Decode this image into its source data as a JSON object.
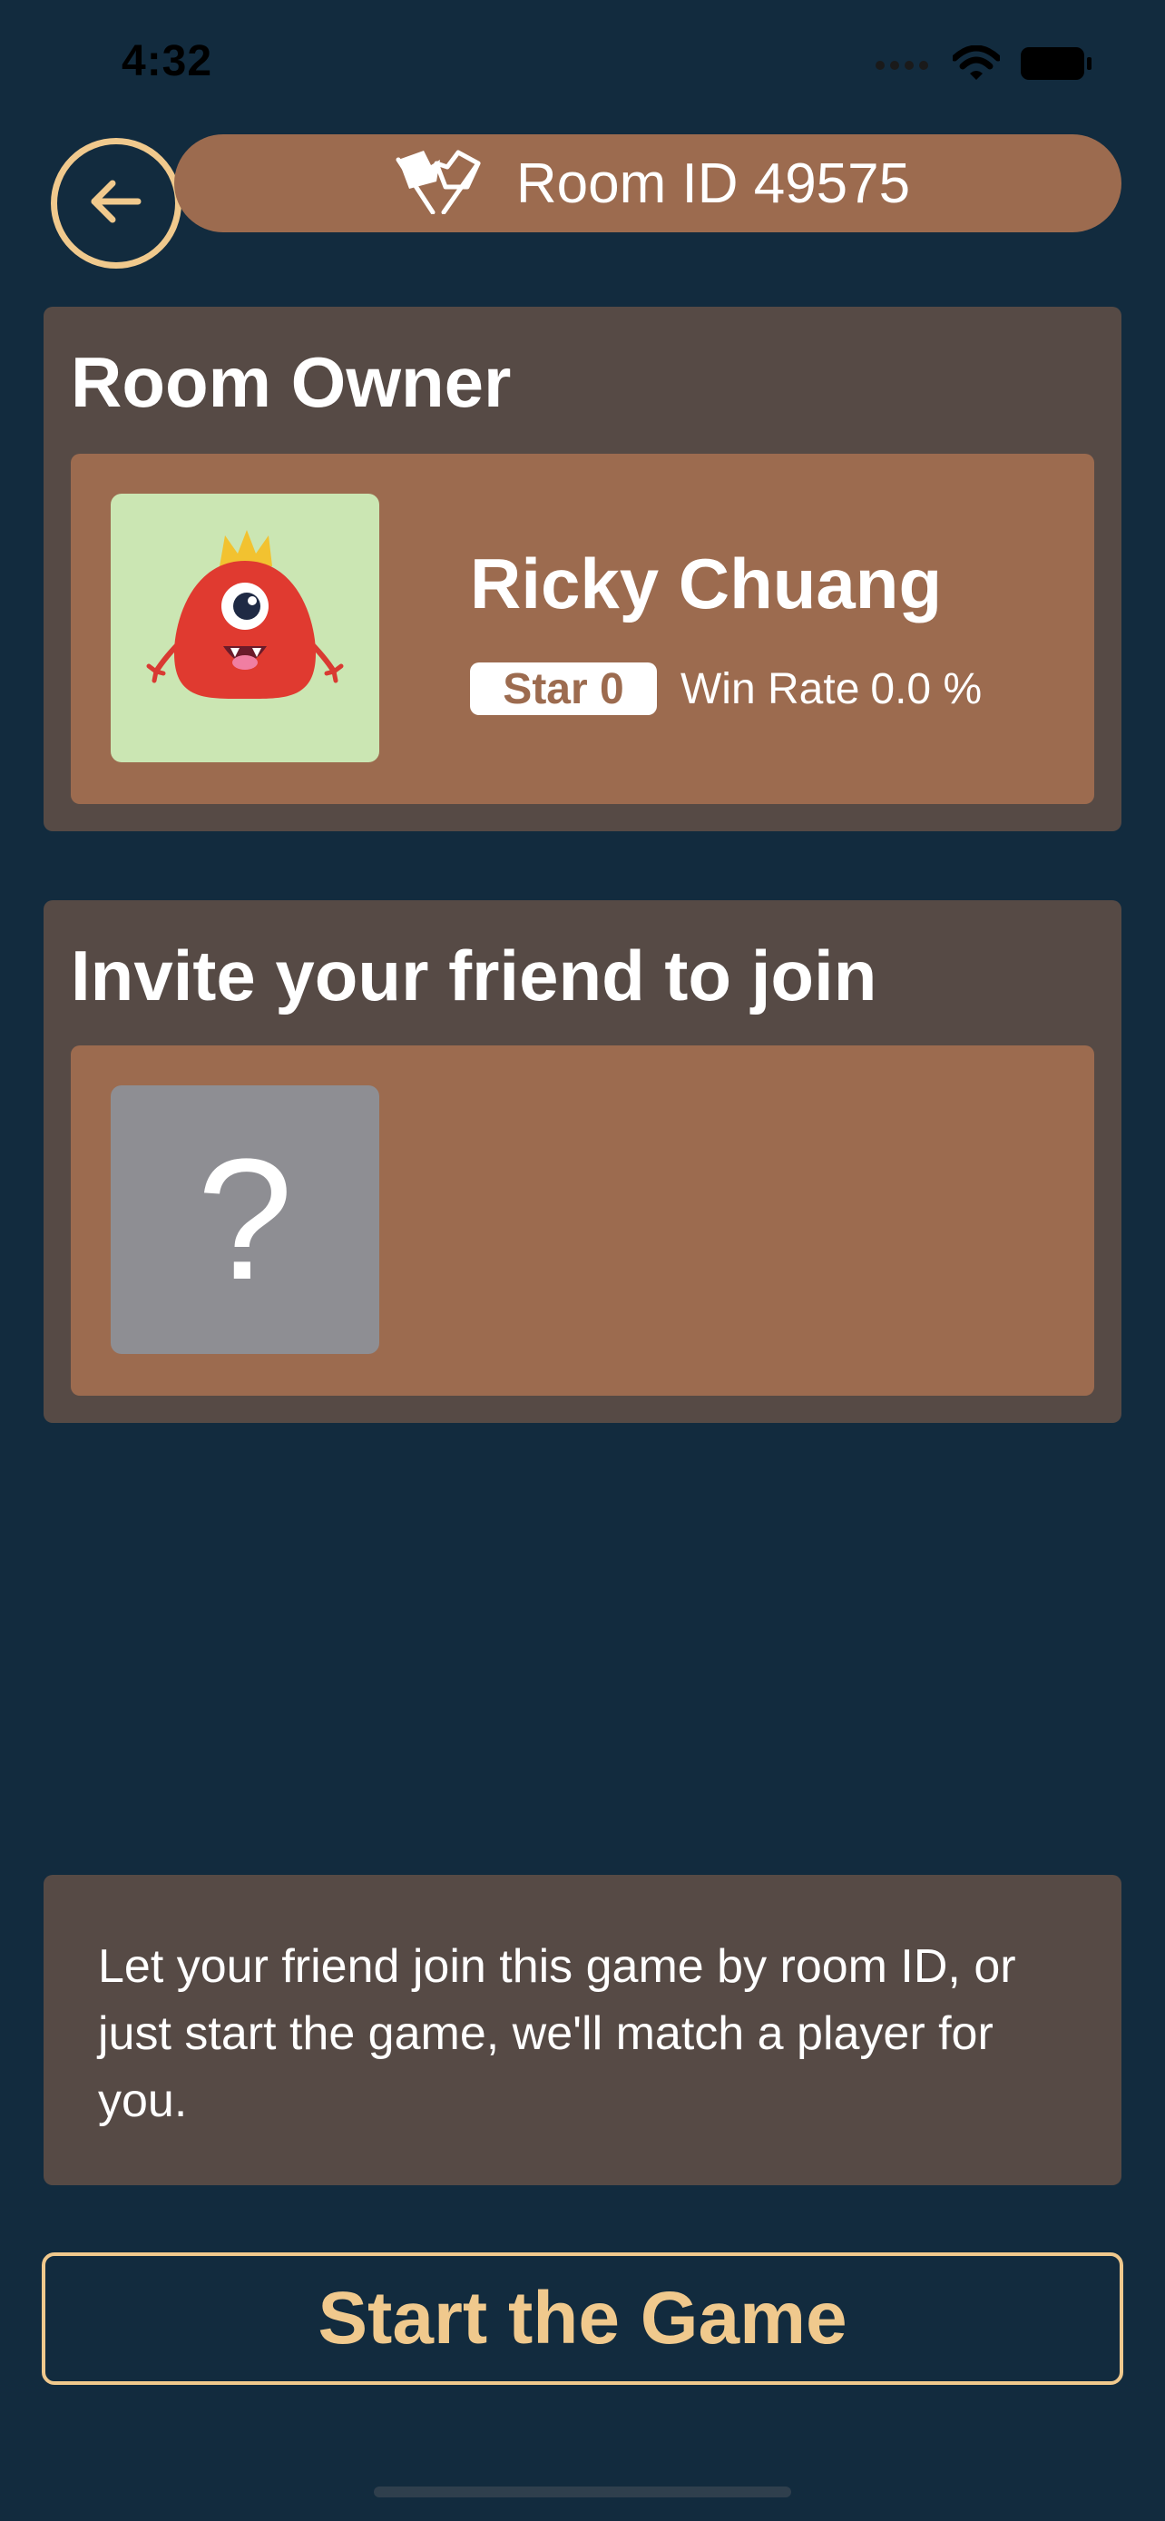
{
  "status_bar": {
    "time": "4:32"
  },
  "header": {
    "room_label": "Room ID 49575",
    "back_icon": "arrow-left-circle-icon",
    "room_icon": "crossed-flags-icon"
  },
  "owner_section": {
    "title": "Room Owner",
    "player": {
      "name": "Ricky Chuang",
      "star_label": "Star 0",
      "win_rate_label": "Win Rate",
      "win_rate_value": "0.0 %",
      "avatar": "red-monster-avatar"
    }
  },
  "invite_section": {
    "title": "Invite your friend to join",
    "placeholder_glyph": "?"
  },
  "info": {
    "text": "Let your friend join this game by room ID, or just start the game, we'll match a player for you."
  },
  "actions": {
    "start_label": "Start the Game"
  },
  "colors": {
    "background": "#122b3e",
    "panel": "#564a45",
    "card": "#9c6b4f",
    "accent": "#f0c98d",
    "avatar_bg": "#cbe6b3",
    "placeholder_bg": "#8e8e93"
  }
}
